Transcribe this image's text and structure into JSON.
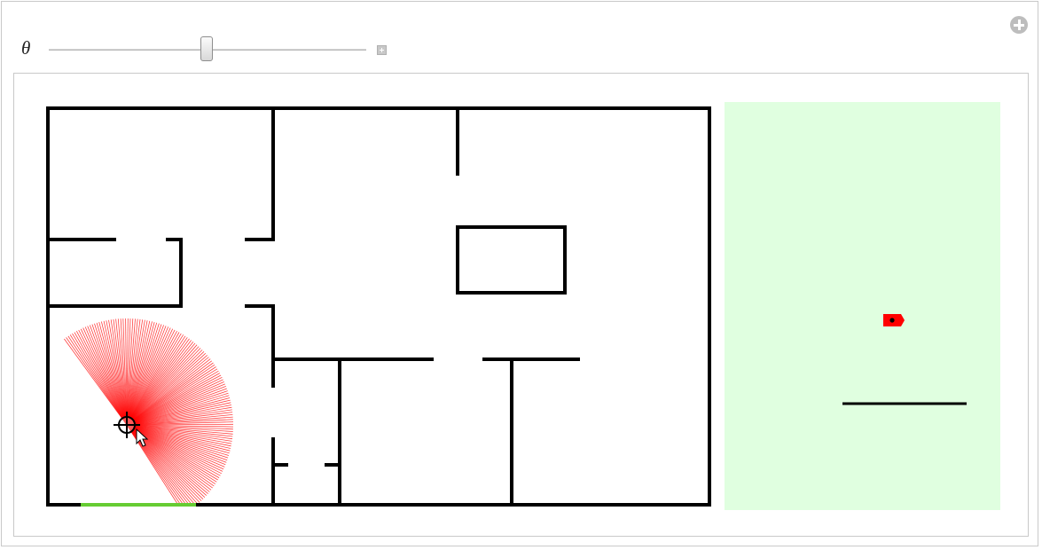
{
  "control": {
    "label": "θ",
    "slider_value_fraction": 0.5
  },
  "icons": {
    "add": "plus-circle-icon",
    "expand": "slider-expand-icon",
    "locator": "crosshair-icon",
    "cursor": "mouse-pointer-icon"
  },
  "colors": {
    "walls": "#000000",
    "sensor_rays": "#ff0000",
    "detected_segment": "#66cc33",
    "local_view_background": "#e0ffe0",
    "robot": "#ff0000"
  }
}
